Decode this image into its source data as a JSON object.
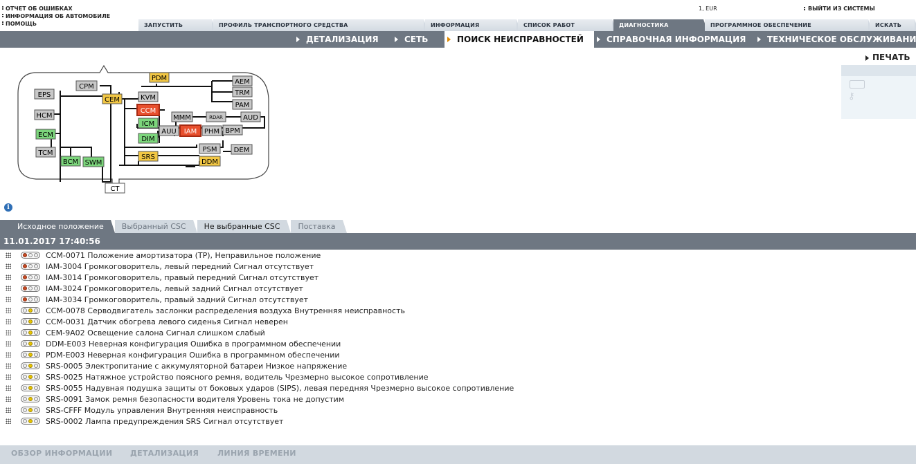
{
  "top_links": [
    "ОТЧЕТ ОБ ОШИБКАХ",
    "ИНФОРМАЦИЯ ОБ АВТОМОБИЛЕ",
    "ПОМОЩЬ"
  ],
  "currency": "1, EUR",
  "logout_label": "ВЫЙТИ ИЗ СИСТЕМЫ",
  "main_tabs": [
    {
      "label": "ЗАПУСТИТЬ",
      "active": false
    },
    {
      "label": "ПРОФИЛЬ ТРАНСПОРТНОГО СРЕДСТВА",
      "active": false
    },
    {
      "label": "ИНФОРМАЦИЯ",
      "active": false
    },
    {
      "label": "СПИСОК РАБОТ",
      "active": false
    },
    {
      "label": "ДИАГНОСТИКА",
      "active": true
    },
    {
      "label": "ПРОГРАММНОЕ ОБЕСПЕЧЕНИЕ",
      "active": false
    },
    {
      "label": "ИСКАТЬ",
      "active": false
    }
  ],
  "sub_tabs": [
    {
      "label": "ДЕТАЛИЗАЦИЯ",
      "active": false
    },
    {
      "label": "СЕТЬ",
      "active": false
    },
    {
      "label": "ПОИСК НЕИСПРАВНОСТЕЙ",
      "active": true
    },
    {
      "label": "СПРАВОЧНАЯ ИНФОРМАЦИЯ",
      "active": false
    },
    {
      "label": "ТЕХНИЧЕСКОЕ ОБСЛУЖИВАНИЕ",
      "active": false
    }
  ],
  "print_label": "ПЕЧАТЬ",
  "colors": {
    "ok": "#7cd67c",
    "warning": "#f2c744",
    "fault": "#e8502e",
    "normal": "#c8c8c8",
    "bar": "#6e7782"
  },
  "modules": [
    {
      "id": "PDM",
      "status": "warning"
    },
    {
      "id": "CPM",
      "status": "normal"
    },
    {
      "id": "CEM",
      "status": "warning"
    },
    {
      "id": "KVM",
      "status": "normal"
    },
    {
      "id": "AEM",
      "status": "normal"
    },
    {
      "id": "TRM",
      "status": "normal"
    },
    {
      "id": "PAM",
      "status": "normal"
    },
    {
      "id": "EPS",
      "status": "normal"
    },
    {
      "id": "HCM",
      "status": "normal"
    },
    {
      "id": "ECM",
      "status": "ok"
    },
    {
      "id": "TCM",
      "status": "normal"
    },
    {
      "id": "CCM",
      "status": "fault"
    },
    {
      "id": "ICM",
      "status": "ok"
    },
    {
      "id": "MMM",
      "status": "normal"
    },
    {
      "id": "RDAR",
      "status": "normal"
    },
    {
      "id": "AUD",
      "status": "normal"
    },
    {
      "id": "AUU",
      "status": "normal"
    },
    {
      "id": "IAM",
      "status": "fault"
    },
    {
      "id": "PHM",
      "status": "normal"
    },
    {
      "id": "BPM",
      "status": "normal"
    },
    {
      "id": "DIM",
      "status": "ok"
    },
    {
      "id": "SRS",
      "status": "warning"
    },
    {
      "id": "PSM",
      "status": "normal"
    },
    {
      "id": "DDM",
      "status": "warning"
    },
    {
      "id": "DEM",
      "status": "normal"
    },
    {
      "id": "BCM",
      "status": "ok"
    },
    {
      "id": "SWM",
      "status": "ok"
    },
    {
      "id": "CT",
      "status": "white"
    }
  ],
  "result_tabs": [
    {
      "label": "Исходное положение",
      "style": "active"
    },
    {
      "label": "Выбранный CSC",
      "style": "selected"
    },
    {
      "label": "Не выбранные CSC",
      "style": "notsel"
    },
    {
      "label": "Поставка",
      "style": "delivery"
    }
  ],
  "timestamp": "11.01.2017 17:40:56",
  "dtcs": [
    {
      "lamp": "red",
      "text": "CCM-0071 Положение амортизатора (ТР), Неправильное положение"
    },
    {
      "lamp": "red",
      "text": "IAM-3004 Громкоговоритель, левый передний Сигнал отсутствует"
    },
    {
      "lamp": "red",
      "text": "IAM-3014 Громкоговоритель, правый передний Сигнал отсутствует"
    },
    {
      "lamp": "red",
      "text": "IAM-3024 Громкоговоритель, левый задний Сигнал отсутствует"
    },
    {
      "lamp": "red",
      "text": "IAM-3034 Громкоговоритель, правый задний Сигнал отсутствует"
    },
    {
      "lamp": "yellow",
      "text": "CCM-0078 Серводвигатель заслонки распределения воздуха Внутренняя неисправность"
    },
    {
      "lamp": "yellow",
      "text": "CCM-0031 Датчик обогрева левого сиденья Сигнал неверен"
    },
    {
      "lamp": "yellow",
      "text": "CEM-9A02 Освещение салона Сигнал слишком слабый"
    },
    {
      "lamp": "yellow",
      "text": "DDM-E003 Неверная конфигурация Ошибка в программном обеспечении"
    },
    {
      "lamp": "yellow",
      "text": "PDM-E003 Неверная конфигурация Ошибка в программном обеспечении"
    },
    {
      "lamp": "yellow",
      "text": "SRS-0005 Электропитание с аккумуляторной батареи Низкое напряжение"
    },
    {
      "lamp": "yellow",
      "text": "SRS-0025 Натяжное устройство поясного ремня, водитель Чрезмерно высокое сопротивление"
    },
    {
      "lamp": "yellow",
      "text": "SRS-0055 Надувная подушка защиты от боковых ударов (SIPS), левая передняя Чрезмерно высокое сопротивление"
    },
    {
      "lamp": "yellow",
      "text": "SRS-0091 Замок ремня безопасности водителя Уровень тока не допустим"
    },
    {
      "lamp": "yellow",
      "text": "SRS-CFFF Модуль управления Внутренняя неисправность"
    },
    {
      "lamp": "yellow",
      "text": "SRS-0002 Лампа предупреждения SRS Сигнал отсутствует"
    }
  ],
  "bottom_tabs": [
    "ОБЗОР ИНФОРМАЦИИ",
    "ДЕТАЛИЗАЦИЯ",
    "ЛИНИЯ ВРЕМЕНИ"
  ]
}
